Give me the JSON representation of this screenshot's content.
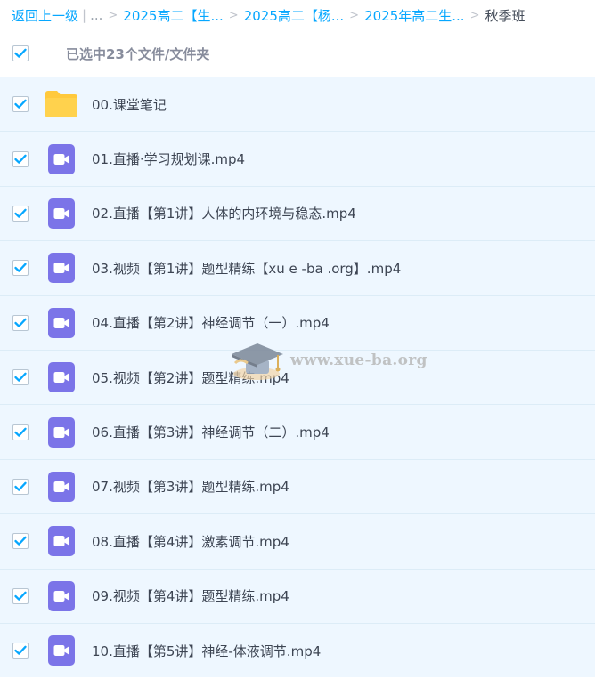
{
  "breadcrumb": {
    "back_label": "返回上一级",
    "bar": "|",
    "ellipsis": "...",
    "separator": ">",
    "crumbs": [
      "2025高二【生...",
      "2025高二【杨...",
      "2025年高二生..."
    ],
    "current": "秋季班"
  },
  "selection": {
    "summary": "已选中23个文件/文件夹",
    "all_checked": true
  },
  "colors": {
    "link": "#06a7ff",
    "checkbox_check": "#06a7ff",
    "row_background": "#eef7ff",
    "video_icon": "#7b74e8",
    "folder_icon": "#ffc93c"
  },
  "files": [
    {
      "name": "00.课堂笔记",
      "type": "folder-icon",
      "checked": true
    },
    {
      "name": "01.直播·学习规划课.mp4",
      "type": "video-icon",
      "checked": true
    },
    {
      "name": "02.直播【第1讲】人体的内环境与稳态.mp4",
      "type": "video-icon",
      "checked": true
    },
    {
      "name": "03.视频【第1讲】题型精练【xu e -ba .org】.mp4",
      "type": "video-icon",
      "checked": true
    },
    {
      "name": "04.直播【第2讲】神经调节（一）.mp4",
      "type": "video-icon",
      "checked": true
    },
    {
      "name": "05.视频【第2讲】题型精练.mp4",
      "type": "video-icon",
      "checked": true
    },
    {
      "name": "06.直播【第3讲】神经调节（二）.mp4",
      "type": "video-icon",
      "checked": true
    },
    {
      "name": "07.视频【第3讲】题型精练.mp4",
      "type": "video-icon",
      "checked": true
    },
    {
      "name": "08.直播【第4讲】激素调节.mp4",
      "type": "video-icon",
      "checked": true
    },
    {
      "name": "09.视频【第4讲】题型精练.mp4",
      "type": "video-icon",
      "checked": true
    },
    {
      "name": "10.直播【第5讲】神经-体液调节.mp4",
      "type": "video-icon",
      "checked": true
    }
  ],
  "watermark": {
    "text": "www.xue-ba.org",
    "icon": "graduation-cap-logo"
  }
}
